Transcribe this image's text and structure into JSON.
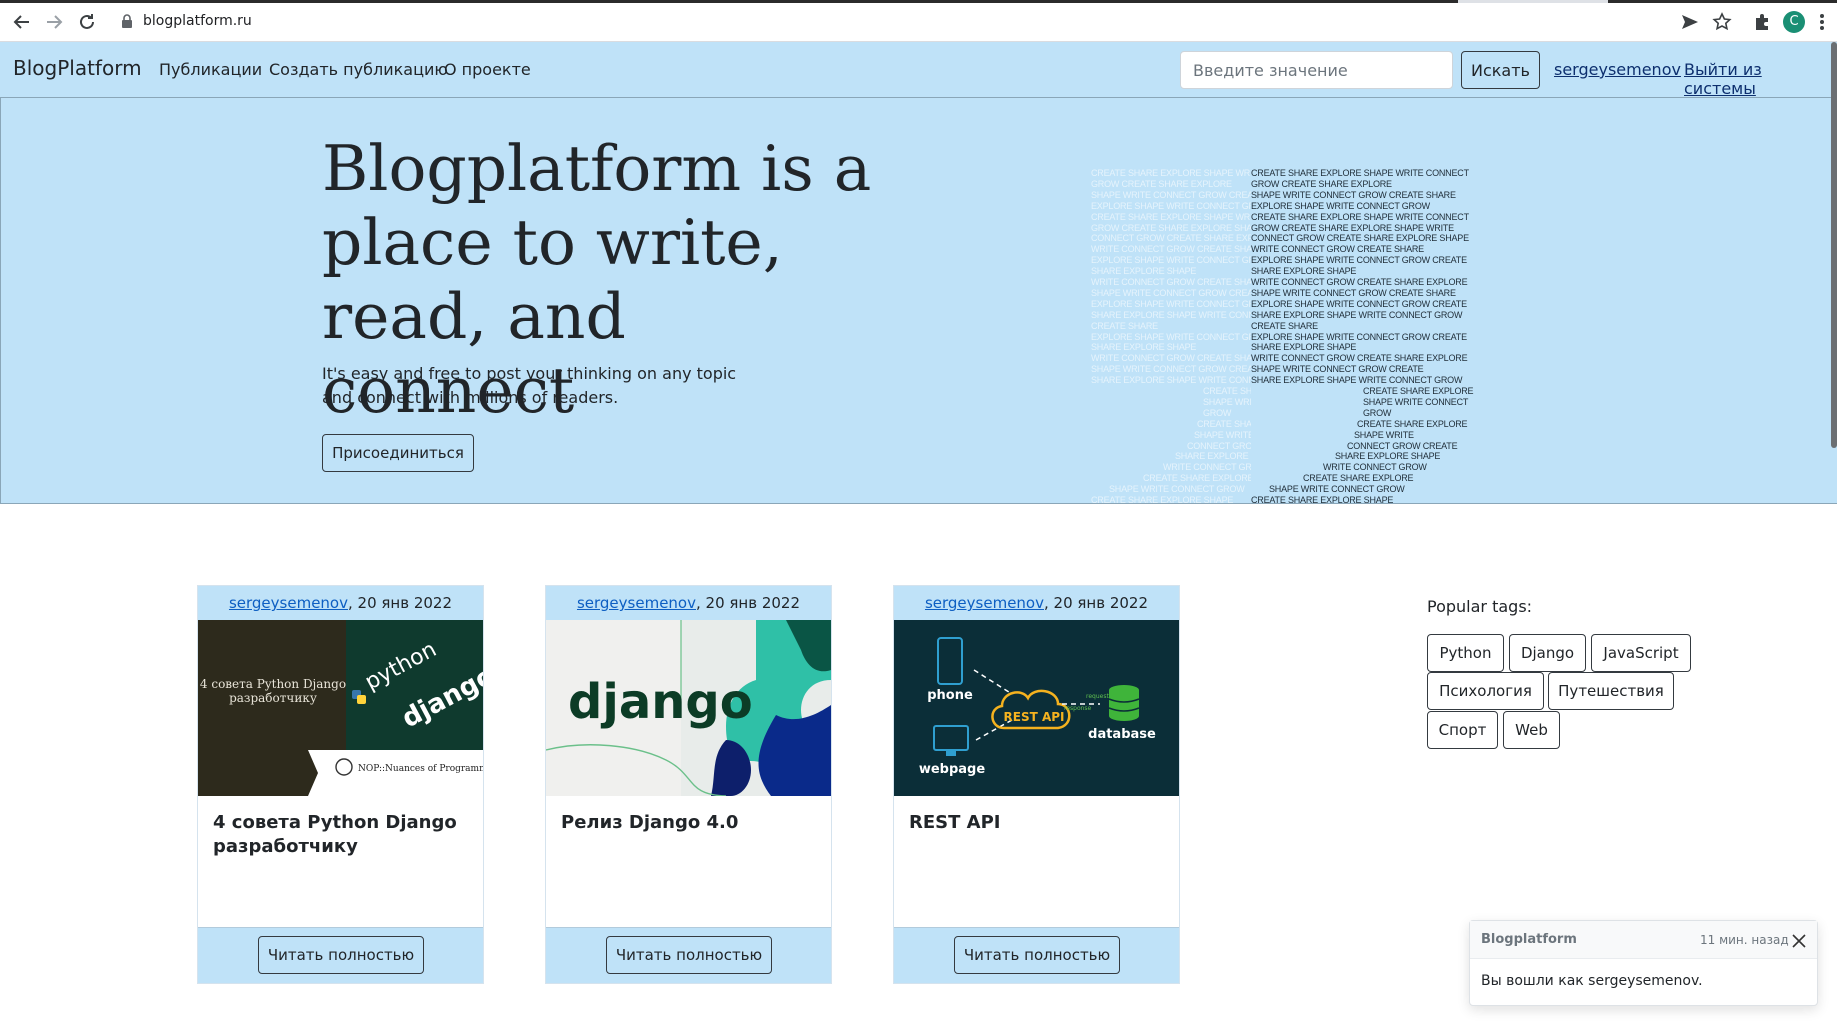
{
  "browser": {
    "url": "blogplatform.ru",
    "profile_initial": "C"
  },
  "navbar": {
    "brand": "BlogPlatform",
    "links": [
      "Публикации",
      "Создать публикацию",
      "О проекте"
    ],
    "search_placeholder": "Введите значение",
    "search_button": "Искать",
    "username": "sergeysemenov",
    "logout": "Выйти из системы"
  },
  "hero": {
    "title": "Blogplatform is a place to write, read, and connect",
    "subtitle": "It's easy and free to post your thinking on any topic and connect with millions of readers.",
    "join_button": "Присоединиться",
    "word_art_lines": [
      "CREATE SHARE EXPLORE SHAPE WRITE CONNECT",
      "GROW CREATE SHARE EXPLORE",
      "SHAPE WRITE CONNECT GROW CREATE SHARE",
      "EXPLORE SHAPE WRITE CONNECT GROW",
      "CREATE SHARE EXPLORE SHAPE WRITE CONNECT",
      "GROW CREATE SHARE EXPLORE SHAPE WRITE",
      "CONNECT GROW CREATE SHARE EXPLORE SHAPE",
      "WRITE CONNECT GROW CREATE SHARE",
      "EXPLORE SHAPE WRITE CONNECT GROW CREATE",
      "SHARE EXPLORE SHAPE",
      "WRITE CONNECT GROW CREATE SHARE EXPLORE",
      "SHAPE WRITE CONNECT GROW CREATE SHARE",
      "EXPLORE SHAPE WRITE CONNECT GROW CREATE",
      "SHARE EXPLORE SHAPE WRITE CONNECT GROW",
      "CREATE SHARE",
      "EXPLORE SHAPE WRITE CONNECT GROW CREATE",
      "SHARE EXPLORE SHAPE",
      "WRITE CONNECT GROW CREATE SHARE EXPLORE",
      "SHAPE WRITE CONNECT GROW CREATE",
      "SHARE EXPLORE SHAPE WRITE CONNECT GROW",
      "CREATE SHARE EXPLORE",
      "SHAPE WRITE CONNECT",
      "GROW",
      "CREATE SHARE EXPLORE",
      "SHAPE WRITE",
      "CONNECT GROW CREATE",
      "SHARE EXPLORE SHAPE",
      "WRITE CONNECT GROW",
      "CREATE SHARE EXPLORE",
      "SHAPE WRITE CONNECT GROW",
      "CREATE SHARE EXPLORE SHAPE",
      "WRITE CONNECT GROW CREATE"
    ]
  },
  "posts": [
    {
      "author": "sergeysemenov",
      "date": ", 20 янв 2022",
      "title": "4 совета Python Django разработчику",
      "image_text": [
        "4 совета Python Django",
        "разработчику",
        "python",
        "django",
        "NOP::Nuances of Programming"
      ],
      "read_button": "Читать полностью"
    },
    {
      "author": "sergeysemenov",
      "date": ", 20 янв 2022",
      "title": "Релиз Django 4.0",
      "image_text": [
        "django"
      ],
      "read_button": "Читать полностью"
    },
    {
      "author": "sergeysemenov",
      "date": ", 20 янв 2022",
      "title": "REST API",
      "image_text": [
        "phone",
        "webpage",
        "REST API",
        "database",
        "request",
        "response"
      ],
      "read_button": "Читать полностью"
    }
  ],
  "tags": {
    "title": "Popular tags:",
    "items": [
      "Python",
      "Django",
      "JavaScript",
      "Психология",
      "Путешествия",
      "Спорт",
      "Web"
    ]
  },
  "toast": {
    "title": "Blogplatform",
    "time": "11 мин. назад",
    "message": "Вы вошли как sergeysemenov."
  },
  "colors": {
    "accent_bg": "#bfe2f8",
    "link": "#0d5ec2",
    "profile": "#1a8f74"
  }
}
